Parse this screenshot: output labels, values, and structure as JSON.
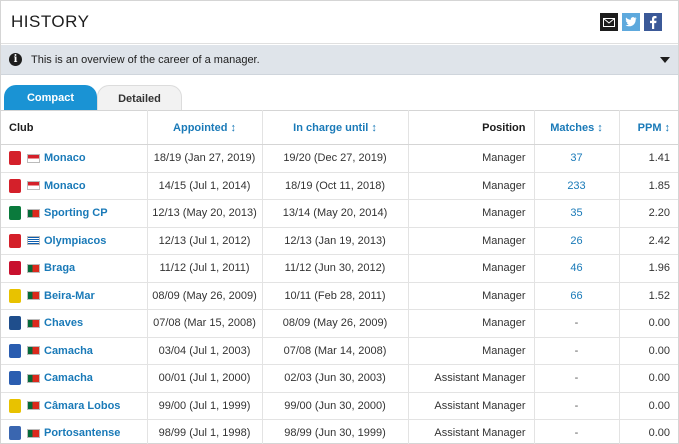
{
  "header": {
    "title": "HISTORY"
  },
  "info": {
    "text": "This is an overview of the career of a manager."
  },
  "tabs": [
    {
      "label": "Compact"
    },
    {
      "label": "Detailed"
    }
  ],
  "columns": {
    "club": "Club",
    "appointed": "Appointed",
    "until": "In charge until",
    "position": "Position",
    "matches": "Matches",
    "ppm": "PPM",
    "sort_arrows": "↕"
  },
  "rows": [
    {
      "club": "Monaco",
      "crest_color": "#d4202a",
      "flag": "monaco",
      "appointed": "18/19 (Jan 27, 2019)",
      "until": "19/20 (Dec 27, 2019)",
      "position": "Manager",
      "matches": "37",
      "ppm": "1.41"
    },
    {
      "club": "Monaco",
      "crest_color": "#d4202a",
      "flag": "monaco",
      "appointed": "14/15 (Jul 1, 2014)",
      "until": "18/19 (Oct 11, 2018)",
      "position": "Manager",
      "matches": "233",
      "ppm": "1.85"
    },
    {
      "club": "Sporting CP",
      "crest_color": "#0a7a3c",
      "flag": "portugal",
      "appointed": "12/13 (May 20, 2013)",
      "until": "13/14 (May 20, 2014)",
      "position": "Manager",
      "matches": "35",
      "ppm": "2.20"
    },
    {
      "club": "Olympiacos",
      "crest_color": "#d4202a",
      "flag": "greece",
      "appointed": "12/13 (Jul 1, 2012)",
      "until": "12/13 (Jan 19, 2013)",
      "position": "Manager",
      "matches": "26",
      "ppm": "2.42"
    },
    {
      "club": "Braga",
      "crest_color": "#c8102e",
      "flag": "portugal",
      "appointed": "11/12 (Jul 1, 2011)",
      "until": "11/12 (Jun 30, 2012)",
      "position": "Manager",
      "matches": "46",
      "ppm": "1.96"
    },
    {
      "club": "Beira-Mar",
      "crest_color": "#e8c200",
      "flag": "portugal",
      "appointed": "08/09 (May 26, 2009)",
      "until": "10/11 (Feb 28, 2011)",
      "position": "Manager",
      "matches": "66",
      "ppm": "1.52"
    },
    {
      "club": "Chaves",
      "crest_color": "#1f4e8c",
      "flag": "portugal",
      "appointed": "07/08 (Mar 15, 2008)",
      "until": "08/09 (May 26, 2009)",
      "position": "Manager",
      "matches": "-",
      "ppm": "0.00"
    },
    {
      "club": "Camacha",
      "crest_color": "#2a5db0",
      "flag": "portugal",
      "appointed": "03/04 (Jul 1, 2003)",
      "until": "07/08 (Mar 14, 2008)",
      "position": "Manager",
      "matches": "-",
      "ppm": "0.00"
    },
    {
      "club": "Camacha",
      "crest_color": "#2a5db0",
      "flag": "portugal",
      "appointed": "00/01 (Jul 1, 2000)",
      "until": "02/03 (Jun 30, 2003)",
      "position": "Assistant Manager",
      "matches": "-",
      "ppm": "0.00"
    },
    {
      "club": "Câmara Lobos",
      "crest_color": "#e8c200",
      "flag": "portugal",
      "appointed": "99/00 (Jul 1, 1999)",
      "until": "99/00 (Jun 30, 2000)",
      "position": "Assistant Manager",
      "matches": "-",
      "ppm": "0.00"
    },
    {
      "club": "Portosantense",
      "crest_color": "#3a66b0",
      "flag": "portugal",
      "appointed": "98/99 (Jul 1, 1998)",
      "until": "98/99 (Jun 30, 1999)",
      "position": "Assistant Manager",
      "matches": "-",
      "ppm": "0.00"
    }
  ]
}
